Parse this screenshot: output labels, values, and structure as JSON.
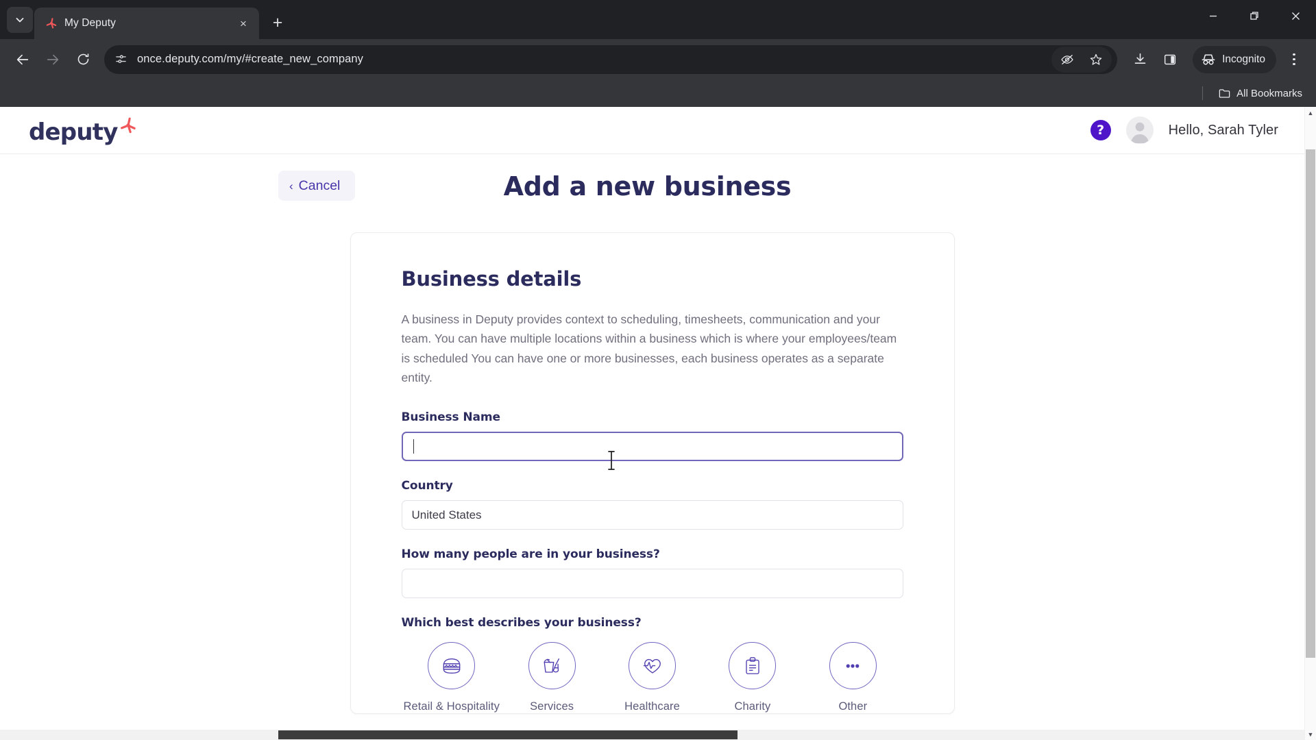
{
  "browser": {
    "tab": {
      "title": "My Deputy",
      "favicon": "deputy-logo-icon",
      "close_label": "×"
    },
    "new_tab_label": "+",
    "tab_search_icon": "chevron-down-icon",
    "window": {
      "minimize": "minimize-icon",
      "maximize": "restore-icon",
      "close": "close-icon"
    },
    "nav": {
      "back": "back-arrow-icon",
      "forward": "forward-arrow-icon",
      "reload": "reload-icon"
    },
    "omnibox": {
      "url": "once.deputy.com/my/#create_new_company",
      "site_info_icon": "site-settings-icon"
    },
    "actions": {
      "tracking_protection": "eye-slash-icon",
      "bookmark": "star-icon",
      "downloads": "download-icon",
      "side_panel": "side-panel-icon",
      "incognito_label": "Incognito",
      "incognito_icon": "incognito-hat-icon",
      "menu": "three-dot-menu-icon"
    },
    "bookmarks": {
      "all_bookmarks_label": "All Bookmarks",
      "folder_icon": "folder-icon"
    }
  },
  "site": {
    "logo_text": "deputy",
    "logo_mark": "deputy-star-icon",
    "help_icon": "help-question-icon",
    "avatar_icon": "user-avatar-icon",
    "greeting": "Hello, Sarah Tyler"
  },
  "page": {
    "cancel_label": "Cancel",
    "cancel_chevron": "chevron-left-icon",
    "title": "Add a new business"
  },
  "card": {
    "heading": "Business details",
    "description": "A business in Deputy provides context to scheduling, timesheets, communication and your team. You can have multiple locations within a business which is where your employees/team is scheduled You can have one or more businesses, each business operates as a separate entity.",
    "fields": [
      {
        "label": "Business Name",
        "value": "",
        "placeholder": "",
        "focused": true
      },
      {
        "label": "Country",
        "value": "United States",
        "placeholder": "",
        "focused": false
      },
      {
        "label": "How many people are in your business?",
        "value": "",
        "placeholder": "",
        "focused": false
      }
    ],
    "category_question": "Which best describes your business?",
    "categories": [
      {
        "label": "Retail & Hospitality",
        "icon": "burger-icon"
      },
      {
        "label": "Services",
        "icon": "bucket-mop-icon"
      },
      {
        "label": "Healthcare",
        "icon": "heart-pulse-icon"
      },
      {
        "label": "Charity",
        "icon": "clipboard-icon"
      },
      {
        "label": "Other",
        "icon": "ellipsis-icon"
      }
    ]
  },
  "colors": {
    "brand_purple": "#4e16c8",
    "title_navy": "#2b2b5e",
    "accent_red": "#f0575a",
    "icon_outline": "#6f66c0",
    "chrome_dark": "#35363a"
  }
}
